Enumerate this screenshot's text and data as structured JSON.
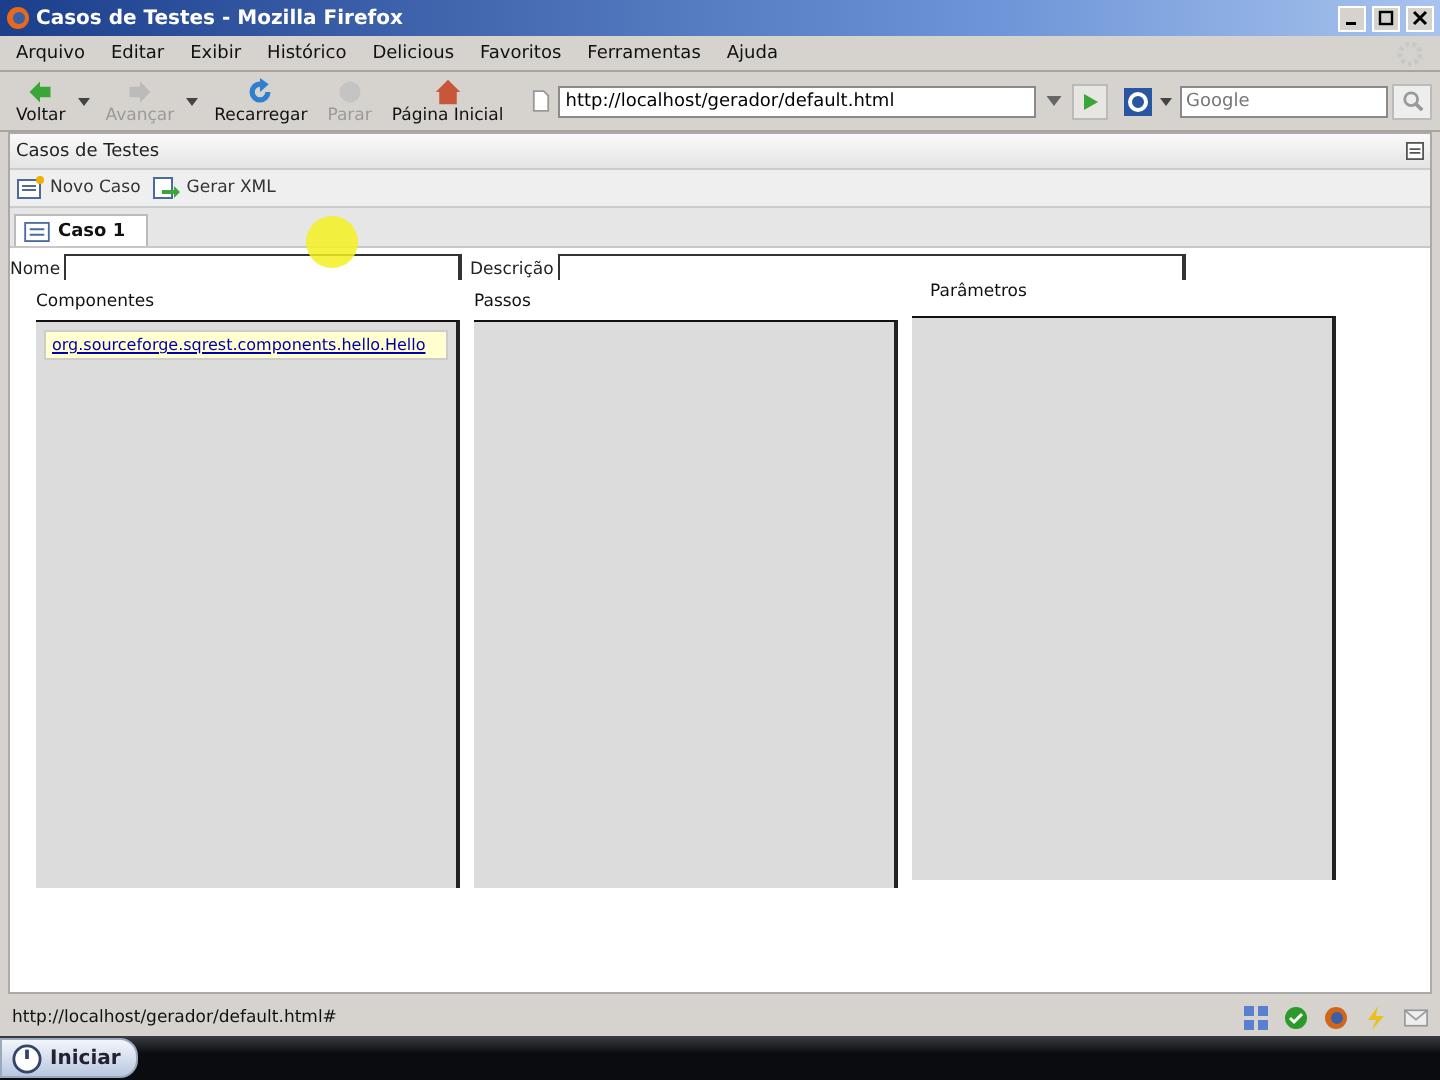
{
  "window": {
    "title": "Casos de Testes - Mozilla Firefox"
  },
  "menu": [
    "Arquivo",
    "Editar",
    "Exibir",
    "Histórico",
    "Delicious",
    "Favoritos",
    "Ferramentas",
    "Ajuda"
  ],
  "nav_buttons": [
    {
      "label": "Voltar",
      "disabled": false,
      "kind": "back",
      "dropdown": true
    },
    {
      "label": "Avançar",
      "disabled": true,
      "kind": "forward",
      "dropdown": true
    },
    {
      "label": "Recarregar",
      "disabled": false,
      "kind": "reload",
      "dropdown": false
    },
    {
      "label": "Parar",
      "disabled": true,
      "kind": "stop",
      "dropdown": false
    },
    {
      "label": "Página Inicial",
      "disabled": false,
      "kind": "home",
      "dropdown": false
    }
  ],
  "address": {
    "value": "http://localhost/gerador/default.html"
  },
  "search": {
    "placeholder": "Google"
  },
  "app": {
    "title": "Casos de Testes",
    "toolbar": [
      {
        "label": "Novo Caso",
        "kind": "new"
      },
      {
        "label": "Gerar XML",
        "kind": "export"
      }
    ],
    "tabs": [
      {
        "label": "Caso 1",
        "selected": true
      }
    ],
    "fields": [
      {
        "label": "Nome"
      },
      {
        "label": "Descrição"
      }
    ],
    "panels": [
      {
        "title": "Componentes",
        "items": [
          {
            "label": "org.sourceforge.sqrest.components.hello.Hello",
            "selected": true
          }
        ]
      },
      {
        "title": "Passos"
      },
      {
        "title": "Parâmetros"
      }
    ]
  },
  "status_bar": {
    "text": "http://localhost/gerador/default.html#"
  },
  "taskbar": {
    "start": "Iniciar"
  }
}
